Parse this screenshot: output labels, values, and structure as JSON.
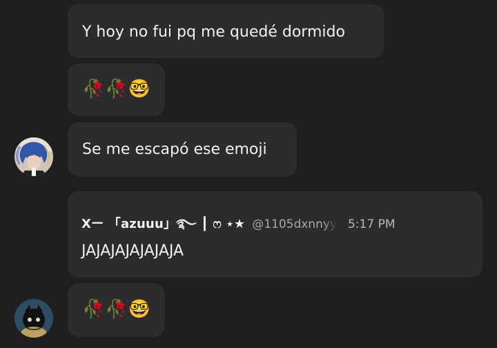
{
  "messages": [
    {
      "text": "Y hoy no fui pq me quedé dormido"
    },
    {
      "text": "🥀🥀🤓"
    },
    {
      "text": "Se me escapó ese emoji"
    },
    {
      "reply_name": "Xー 「azuuu」࿐ ┃ ෆ ⋆★",
      "reply_handle": "@1105dxnnyy",
      "reply_time": "5:17 PM",
      "text": "JAJAJAJAJAJAJA"
    },
    {
      "text": "🥀🥀🤓"
    }
  ],
  "colors": {
    "background": "#1f1f21",
    "bubble": "#2c2c2f",
    "text": "#f2f2f2",
    "muted": "#a9a9ad"
  }
}
